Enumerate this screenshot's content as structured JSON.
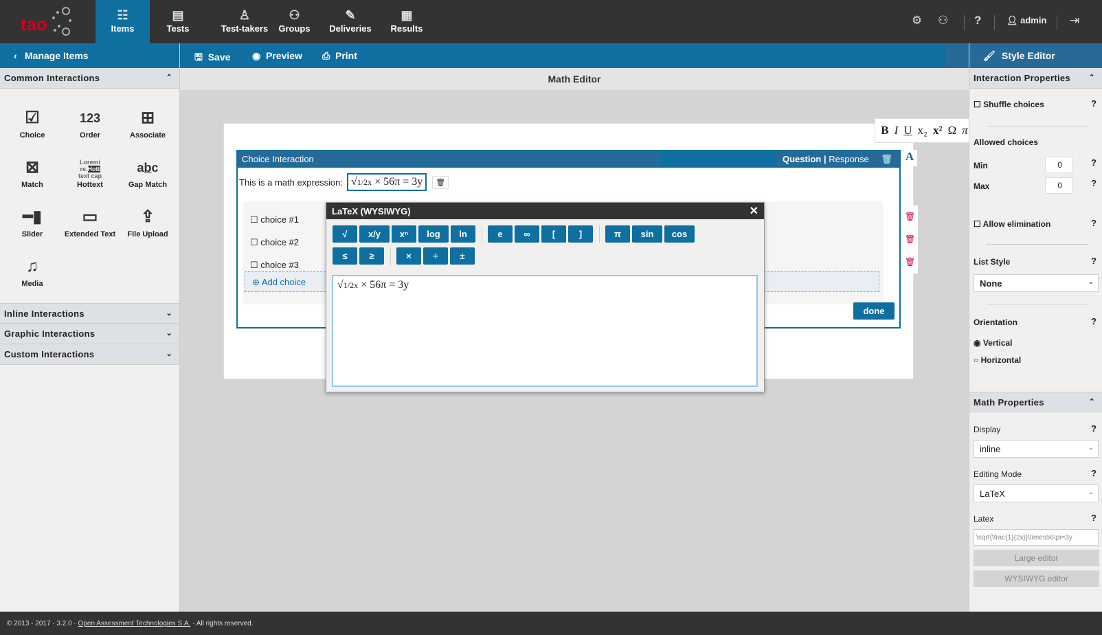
{
  "logo": "tao",
  "nav": [
    {
      "label": "Items",
      "icon": "items-icon",
      "active": true
    },
    {
      "label": "Tests",
      "icon": "tests-icon"
    },
    {
      "label": "Test-takers",
      "icon": "test-takers-icon"
    },
    {
      "label": "Groups",
      "icon": "groups-icon"
    },
    {
      "label": "Deliveries",
      "icon": "deliveries-icon"
    },
    {
      "label": "Results",
      "icon": "results-icon"
    }
  ],
  "user": {
    "name": "admin"
  },
  "actionbar": {
    "manage": "Manage Items",
    "save": "Save",
    "preview": "Preview",
    "print": "Print",
    "style_editor": "Style Editor"
  },
  "left": {
    "common": "Common Interactions",
    "tools": [
      "Choice",
      "Order",
      "Associate",
      "Match",
      "Hottext",
      "Gap Match",
      "Slider",
      "Extended Text",
      "File Upload",
      "Media"
    ],
    "inline": "Inline Interactions",
    "graphic": "Graphic Interactions",
    "custom": "Custom Interactions"
  },
  "main": {
    "title": "Math Editor",
    "interaction_title": "Choice Interaction",
    "question": "Question",
    "response": "Response",
    "prompt": "This is a math expression:",
    "choices": [
      "choice #1",
      "choice #2",
      "choice #3"
    ],
    "add_choice": "Add choice",
    "done": "done"
  },
  "dialog": {
    "title": "LaTeX (WYSIWYG)",
    "row1a": [
      "√",
      "x/y",
      "xⁿ",
      "log",
      "ln"
    ],
    "row1b": [
      "e",
      "∞",
      "[",
      "]"
    ],
    "row1c": [
      "π",
      "sin",
      "cos"
    ],
    "row2a": [
      "≤",
      "≥"
    ],
    "row2b": [
      "×",
      "÷",
      "±"
    ]
  },
  "props": {
    "interaction": "Interaction Properties",
    "shuffle": "Shuffle choices",
    "allowed": "Allowed choices",
    "min_label": "Min",
    "min": "0",
    "max_label": "Max",
    "max": "0",
    "elimination": "Allow elimination",
    "list_style": "List Style",
    "list_style_value": "None",
    "orientation": "Orientation",
    "vertical": "Vertical",
    "horizontal": "Horizontal",
    "math": "Math Properties",
    "display": "Display",
    "display_value": "inline",
    "editing": "Editing Mode",
    "editing_value": "LaTeX",
    "latex": "Latex",
    "latex_value": "\\sqrt{\\frac{1}{2x}}\\times56\\pi=3y",
    "large": "Large editor",
    "wysiwyg": "WYSIWYG editor"
  },
  "footer": {
    "pre": "© 2013 - 2017 · 3.2.0 · ",
    "link": "Open Assessment Technologies S.A.",
    "post": " · All rights reserved."
  },
  "colors": {
    "brand": "#0e6fa0",
    "topbar": "#333333",
    "logo": "#d0021b"
  }
}
